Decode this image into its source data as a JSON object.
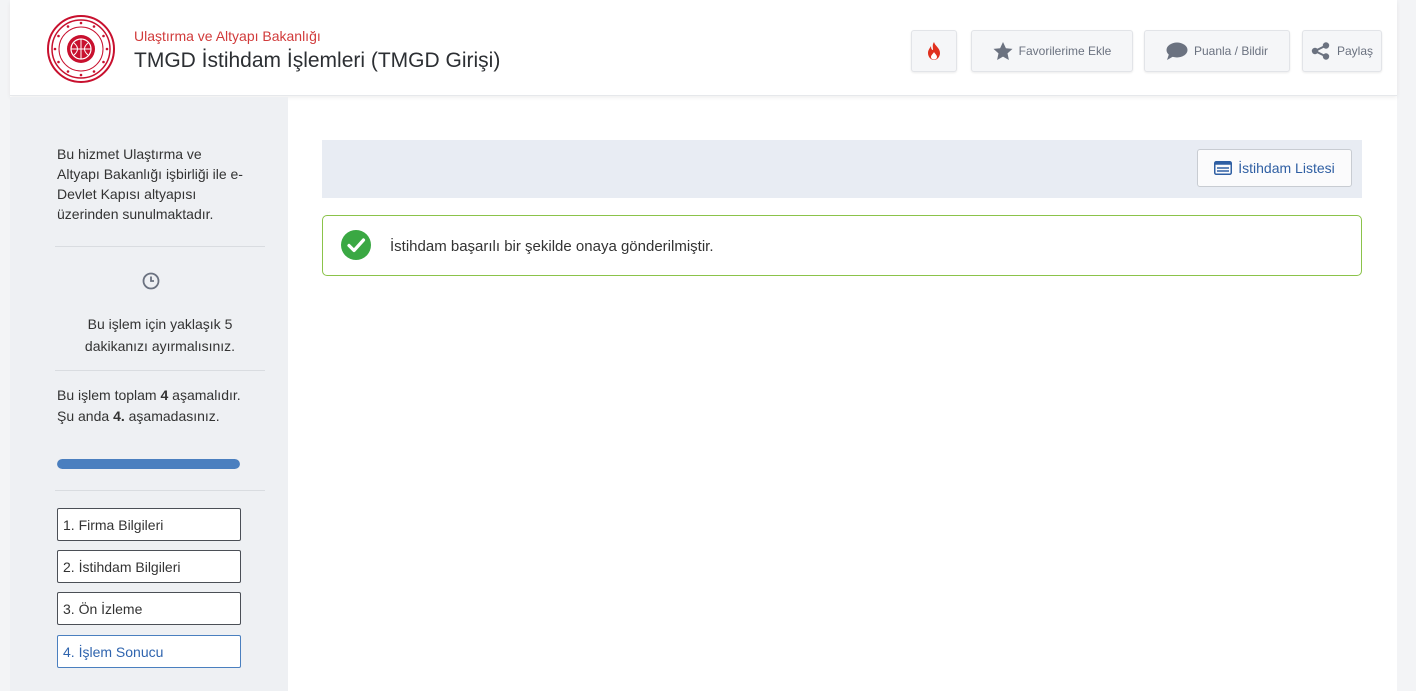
{
  "header": {
    "organization": "Ulaştırma ve Altyapı Bakanlığı",
    "service_title": "TMGD İstihdam İşlemleri (TMGD Girişi)",
    "buttons": {
      "favorite_label": "Favorilerime Ekle",
      "rate_label": "Puanla / Bildir",
      "share_label": "Paylaş"
    },
    "icons": {
      "popular": "flame-icon",
      "favorite": "star-icon",
      "rate": "speech-bubble-icon",
      "share": "share-icon"
    }
  },
  "sidebar": {
    "provider_text": "Bu hizmet Ulaştırma ve Altyapı Bakanlığı işbirliği ile e-Devlet Kapısı altyapısı üzerinden sunulmaktadır.",
    "duration_text": "Bu işlem için yaklaşık 5 dakikanızı ayırmalısınız.",
    "steps_text": {
      "prefix": "Bu işlem toplam ",
      "total": "4",
      "middle": " aşamalıdır. Şu anda ",
      "current": "4.",
      "suffix": " aşamadasınız."
    },
    "progress_fraction": 1.0,
    "steps": [
      {
        "label": "1. Firma Bilgileri",
        "active": false
      },
      {
        "label": "2. İstihdam Bilgileri",
        "active": false
      },
      {
        "label": "3. Ön İzleme",
        "active": false
      },
      {
        "label": "4. İşlem Sonucu",
        "active": true
      }
    ]
  },
  "main": {
    "list_button_label": "İstihdam Listesi",
    "alert_message": "İstihdam başarılı bir şekilde onaya gönderilmiştir."
  },
  "colors": {
    "brand_red": "#c8102e",
    "accent_blue": "#4a7fbf",
    "success_green": "#8bc34a"
  }
}
